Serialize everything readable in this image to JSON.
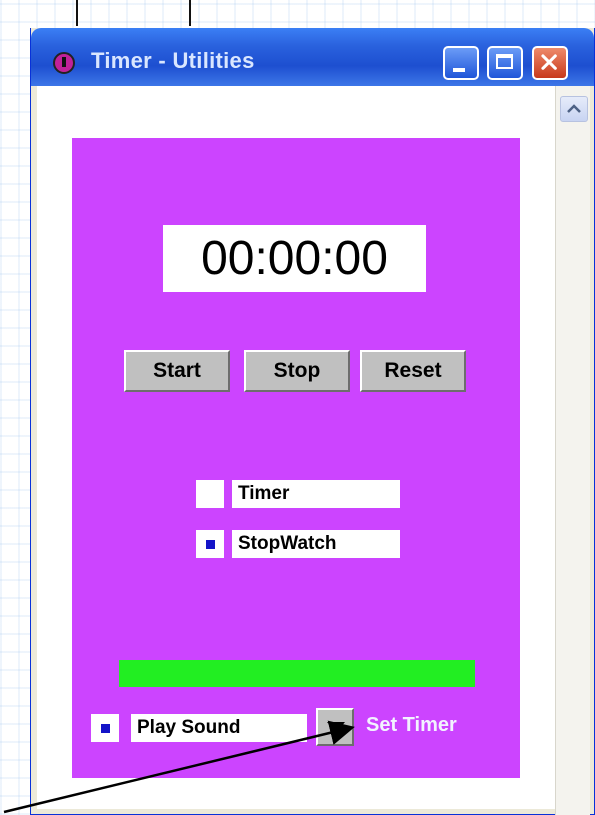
{
  "window": {
    "title": "Timer - Utilities",
    "app_icon": "timer-app-icon",
    "controls": [
      "minimize-icon",
      "maximize-icon",
      "close-icon"
    ]
  },
  "colors": {
    "panel_bg": "#cc44ff",
    "progress_fill": "#22ee22",
    "titlebar": "#1d4fd0"
  },
  "timer": {
    "display": "00:00:00",
    "buttons": {
      "start": "Start",
      "stop": "Stop",
      "reset": "Reset"
    },
    "modes": [
      {
        "label": "Timer",
        "checked": false
      },
      {
        "label": "StopWatch",
        "checked": true
      }
    ],
    "progress": 1.0,
    "play_sound": {
      "label": "Play Sound",
      "checked": true
    },
    "set_timer_label": "Set Timer"
  }
}
